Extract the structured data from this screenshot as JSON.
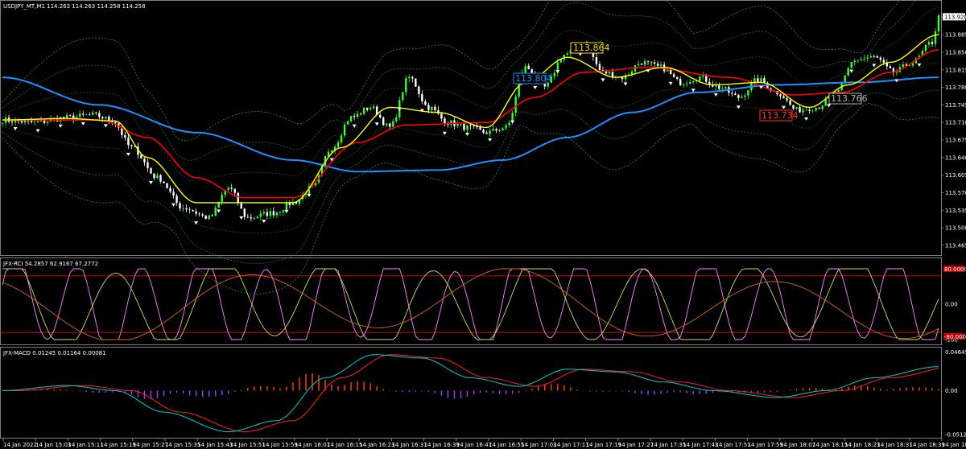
{
  "symbol_header": "USDJPY_MT,M1  114.263 114.263 114.258 114.258",
  "rci_header": "JFX-RCI 54.2857 62.9167 67.2772",
  "macd_header": "JFX-MACD 0.01245 0.01164 0.00081",
  "price_labels": {
    "current": "113.920",
    "tag1": "113.864",
    "tag2": "113.804",
    "tag3": "113.766",
    "tag4": "113.734",
    "rci_top": "80.0000",
    "rci_bot": "-80.0000"
  },
  "colors": {
    "bg": "#000000",
    "bull": "#33ff33",
    "bear": "#ffffff",
    "ma_fast": "#ffff00",
    "ma_mid": "#ff0000",
    "ma_slow": "#1e90ff",
    "bands": "#2e8b57",
    "rci_fast": "#ff88ff",
    "rci_mid": "#c8e060",
    "rci_slow": "#d2691e",
    "macd_up": "#ff4500",
    "macd_dn": "#a040ff",
    "macd_line": "#00ced1",
    "macd_sig": "#ff2020"
  },
  "chart_data": [
    {
      "type": "candlestick",
      "title": "USDJPY_MT,M1",
      "y_ticks": [
        "113.920",
        "113.885",
        "113.850",
        "113.815",
        "113.780",
        "113.745",
        "113.710",
        "113.675",
        "113.640",
        "113.605",
        "113.570",
        "113.535",
        "113.500",
        "113.465"
      ],
      "x_ticks": [
        "14 Jan 2022",
        "14 Jan 15:03",
        "14 Jan 15:11",
        "14 Jan 15:19",
        "14 Jan 15:27",
        "14 Jan 15:35",
        "14 Jan 15:43",
        "14 Jan 15:51",
        "14 Jan 15:59",
        "14 Jan 16:07",
        "14 Jan 16:15",
        "14 Jan 16:23",
        "14 Jan 16:31",
        "14 Jan 16:39",
        "14 Jan 16:47",
        "14 Jan 16:55",
        "14 Jan 17:03",
        "14 Jan 17:11",
        "14 Jan 17:19",
        "14 Jan 17:27",
        "14 Jan 17:35",
        "14 Jan 17:43",
        "14 Jan 17:51",
        "14 Jan 17:59",
        "14 Jan 18:07",
        "14 Jan 18:15",
        "14 Jan 18:23",
        "14 Jan 18:31",
        "14 Jan 18:39",
        "14 Jan 18:47"
      ],
      "ylim": [
        113.46,
        113.935
      ],
      "close_keyframes": [
        [
          0,
          113.715
        ],
        [
          10,
          113.71
        ],
        [
          20,
          113.72
        ],
        [
          28,
          113.725
        ],
        [
          34,
          113.715
        ],
        [
          40,
          113.66
        ],
        [
          48,
          113.6
        ],
        [
          56,
          113.54
        ],
        [
          64,
          113.52
        ],
        [
          70,
          113.58
        ],
        [
          76,
          113.52
        ],
        [
          84,
          113.53
        ],
        [
          90,
          113.55
        ],
        [
          96,
          113.58
        ],
        [
          102,
          113.66
        ],
        [
          108,
          113.72
        ],
        [
          114,
          113.74
        ],
        [
          120,
          113.7
        ],
        [
          126,
          113.8
        ],
        [
          132,
          113.74
        ],
        [
          138,
          113.71
        ],
        [
          144,
          113.7
        ],
        [
          150,
          113.69
        ],
        [
          156,
          113.7
        ],
        [
          162,
          113.82
        ],
        [
          168,
          113.78
        ],
        [
          174,
          113.845
        ],
        [
          180,
          113.87
        ],
        [
          186,
          113.81
        ],
        [
          192,
          113.8
        ],
        [
          198,
          113.83
        ],
        [
          204,
          113.82
        ],
        [
          210,
          113.79
        ],
        [
          216,
          113.8
        ],
        [
          222,
          113.78
        ],
        [
          228,
          113.76
        ],
        [
          234,
          113.795
        ],
        [
          240,
          113.77
        ],
        [
          246,
          113.735
        ],
        [
          252,
          113.74
        ],
        [
          258,
          113.765
        ],
        [
          264,
          113.835
        ],
        [
          270,
          113.84
        ],
        [
          276,
          113.81
        ],
        [
          282,
          113.83
        ],
        [
          288,
          113.87
        ],
        [
          290,
          113.92
        ]
      ],
      "ma_fast": [
        [
          0,
          113.715
        ],
        [
          20,
          113.718
        ],
        [
          35,
          113.713
        ],
        [
          45,
          113.64
        ],
        [
          60,
          113.55
        ],
        [
          75,
          113.55
        ],
        [
          90,
          113.55
        ],
        [
          105,
          113.66
        ],
        [
          120,
          113.74
        ],
        [
          135,
          113.73
        ],
        [
          150,
          113.7
        ],
        [
          162,
          113.79
        ],
        [
          175,
          113.84
        ],
        [
          190,
          113.8
        ],
        [
          205,
          113.82
        ],
        [
          220,
          113.785
        ],
        [
          235,
          113.79
        ],
        [
          250,
          113.74
        ],
        [
          262,
          113.785
        ],
        [
          275,
          113.83
        ],
        [
          290,
          113.885
        ]
      ],
      "ma_mid": [
        [
          0,
          113.715
        ],
        [
          30,
          113.715
        ],
        [
          45,
          113.68
        ],
        [
          60,
          113.6
        ],
        [
          75,
          113.56
        ],
        [
          90,
          113.56
        ],
        [
          110,
          113.67
        ],
        [
          125,
          113.705
        ],
        [
          150,
          113.71
        ],
        [
          165,
          113.76
        ],
        [
          180,
          113.81
        ],
        [
          200,
          113.82
        ],
        [
          225,
          113.8
        ],
        [
          245,
          113.765
        ],
        [
          260,
          113.77
        ],
        [
          275,
          113.81
        ],
        [
          290,
          113.855
        ]
      ],
      "ma_slow": [
        [
          0,
          113.8
        ],
        [
          30,
          113.745
        ],
        [
          60,
          113.69
        ],
        [
          90,
          113.635
        ],
        [
          110,
          113.612
        ],
        [
          135,
          113.615
        ],
        [
          155,
          113.635
        ],
        [
          175,
          113.68
        ],
        [
          195,
          113.73
        ],
        [
          215,
          113.77
        ],
        [
          240,
          113.785
        ],
        [
          265,
          113.79
        ],
        [
          290,
          113.8
        ]
      ]
    },
    {
      "type": "line",
      "title": "JFX-RCI",
      "y_ticks": [
        "100",
        "0.00",
        "-100"
      ],
      "ylim": [
        -100,
        100
      ],
      "levels": [
        80,
        -80
      ]
    },
    {
      "type": "bar",
      "title": "JFX-MACD",
      "y_ticks": [
        "0.04645",
        "0.00",
        "-0.05122"
      ],
      "ylim": [
        -0.05122,
        0.04645
      ],
      "macd_keyframes": [
        [
          0,
          0
        ],
        [
          20,
          0.006
        ],
        [
          35,
          0
        ],
        [
          50,
          -0.025
        ],
        [
          70,
          -0.048
        ],
        [
          85,
          -0.035
        ],
        [
          100,
          0.015
        ],
        [
          115,
          0.042
        ],
        [
          130,
          0.038
        ],
        [
          145,
          0.015
        ],
        [
          160,
          0.005
        ],
        [
          175,
          0.025
        ],
        [
          190,
          0.022
        ],
        [
          205,
          0.01
        ],
        [
          220,
          0.0
        ],
        [
          240,
          -0.008
        ],
        [
          255,
          0.0
        ],
        [
          270,
          0.015
        ],
        [
          290,
          0.028
        ]
      ]
    }
  ]
}
